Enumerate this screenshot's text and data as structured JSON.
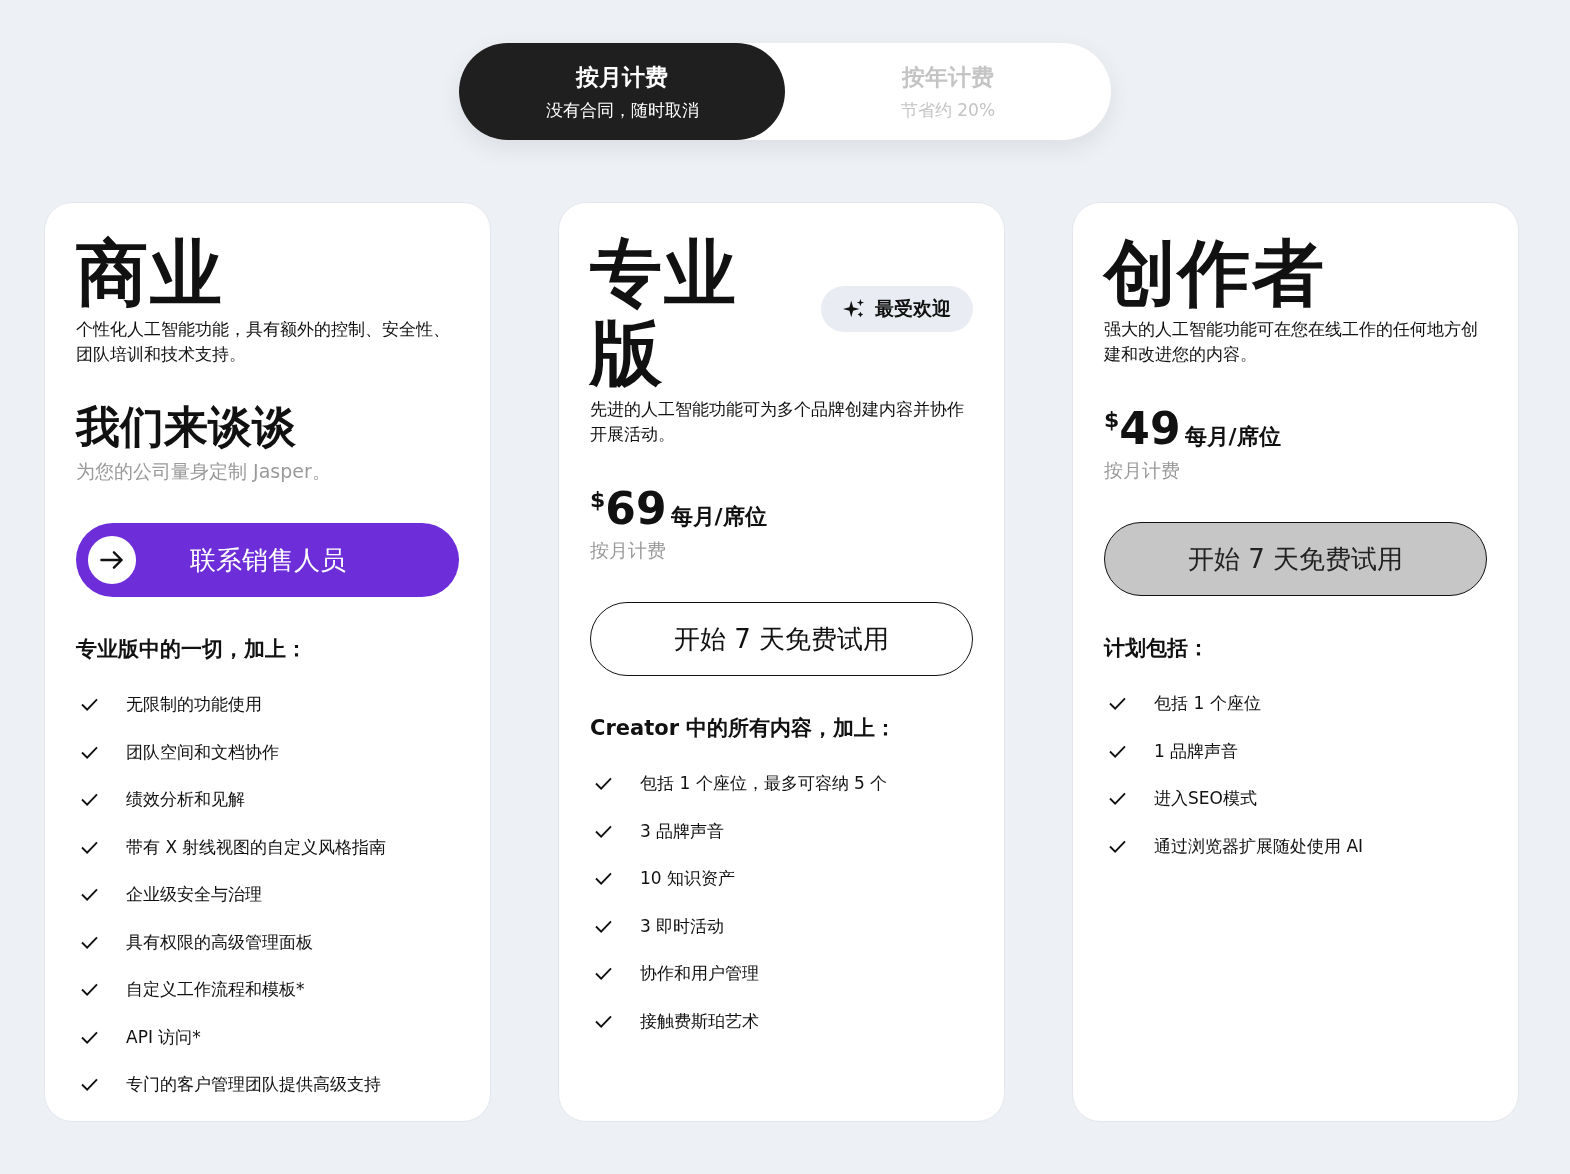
{
  "billing_toggle": [
    {
      "label": "按月计费",
      "sublabel": "没有合同，随时取消",
      "selected": true
    },
    {
      "label": "按年计费",
      "sublabel": "节省约 20%",
      "selected": false
    }
  ],
  "plans": [
    {
      "title": "商业",
      "description": "个性化人工智能功能，具有额外的控制、安全性、团队培训和技术支持。",
      "quote": {
        "headline": "我们来谈谈",
        "subline": "为您的公司量身定制 Jasper。"
      },
      "button": {
        "label": "联系销售人员",
        "kind": "primary"
      },
      "features_heading": "专业版中的一切，加上：",
      "features": [
        "无限制的功能使用",
        "团队空间和文档协作",
        "绩效分析和见解",
        "带有 X 射线视图的自定义风格指南",
        "企业级安全与治理",
        "具有权限的高级管理面板",
        "自定义工作流程和模板*",
        "API 访问*",
        "专门的客户管理团队提供高级支持"
      ]
    },
    {
      "title": "专业版",
      "badge": "最受欢迎",
      "description": "先进的人工智能功能可为多个品牌创建内容并协作开展活动。",
      "price": {
        "currency": "$",
        "amount": "69",
        "unit": "每月/席位",
        "billing": "按月计费"
      },
      "button": {
        "label": "开始 7 天免费试用",
        "kind": "outline"
      },
      "features_heading": "Creator 中的所有内容，加上：",
      "features": [
        "包括 1 个座位，最多可容纳 5 个",
        "3 品牌声音",
        "10 知识资产",
        "3 即时活动",
        "协作和用户管理",
        "接触费斯珀艺术"
      ]
    },
    {
      "title": "创作者",
      "description": "强大的人工智能功能可在您在线工作的任何地方创建和改进您的内容。",
      "price": {
        "currency": "$",
        "amount": "49",
        "unit": "每月/席位",
        "billing": "按月计费"
      },
      "button": {
        "label": "开始 7 天免费试用",
        "kind": "grey"
      },
      "features_heading": "计划包括：",
      "features": [
        "包括 1 个座位",
        "1 品牌声音",
        "进入SEO模式",
        "通过浏览器扩展随处使用 AI"
      ]
    }
  ]
}
